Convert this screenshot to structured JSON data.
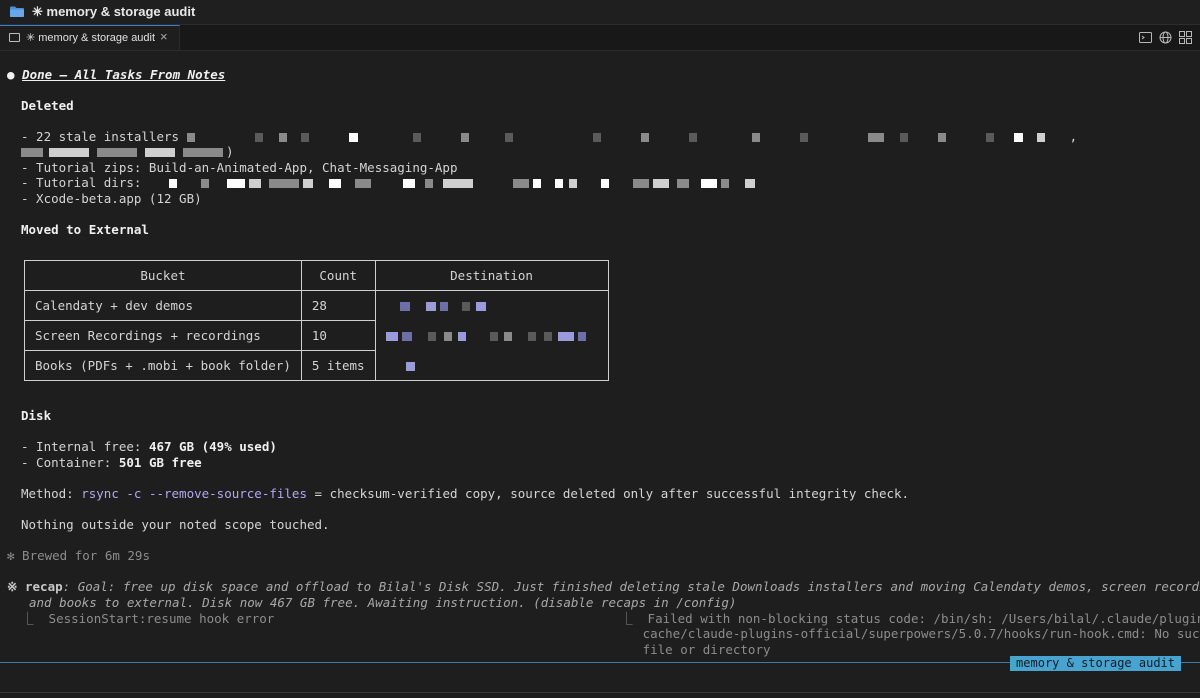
{
  "window": {
    "title": "✳ memory & storage audit"
  },
  "tab": {
    "label": "✳ memory & storage audit",
    "close": "×"
  },
  "tab_actions": [
    {
      "icon": "terminal-icon"
    },
    {
      "icon": "globe-icon"
    },
    {
      "icon": "grid-icon"
    }
  ],
  "output": {
    "heading": "Done — All Tasks From Notes",
    "deleted": {
      "title": "Deleted",
      "line1_prefix": "- 22 stale installers",
      "line1_end": ",",
      "line2_end": ")",
      "line3": "- Tutorial zips: Build-an-Animated-App, Chat-Messaging-App",
      "line4_prefix": "- Tutorial dirs:",
      "line5": "- Xcode-beta.app (12 GB)"
    },
    "moved": {
      "title": "Moved to External",
      "headers": [
        "Bucket",
        "Count",
        "Destination"
      ],
      "rows": [
        {
          "bucket": "Calendaty + dev demos",
          "count": "28"
        },
        {
          "bucket": "Screen Recordings + recordings",
          "count": "10"
        },
        {
          "bucket": "Books (PDFs + .mobi + book folder)",
          "count": "5 items"
        }
      ]
    },
    "disk": {
      "title": "Disk",
      "internal_prefix": "- Internal free: ",
      "internal_value": "467 GB (49% used)",
      "container_prefix": "- Container: ",
      "container_value": "501 GB free"
    },
    "method": {
      "prefix": "Method: ",
      "command": "rsync -c --remove-source-files",
      "suffix": " = checksum-verified copy, source deleted only after successful integrity check."
    },
    "scope_note": "Nothing outside your noted scope touched.",
    "brewed": "✻ Brewed for 6m 29s",
    "recap": {
      "label": "※ recap",
      "line1": ": Goal: free up disk space and offload to Bilal's Disk SSD. Just finished deleting stale Downloads installers and moving Calendaty demos, screen recordings,",
      "line2": "and books to external. Disk now 467 GB free. Awaiting instruction. (disable recaps in /config)"
    },
    "hook_left": "⎿  SessionStart:resume hook error",
    "hook_right": [
      "⎿  Failed with non-blocking status code: /bin/sh: /Users/bilal/.claude/plugins/",
      "   cache/claude-plugins-official/superpowers/5.0.7/hooks/run-hook.cmd: No such",
      "   file or directory"
    ]
  },
  "status_badge": "memory & storage audit"
}
